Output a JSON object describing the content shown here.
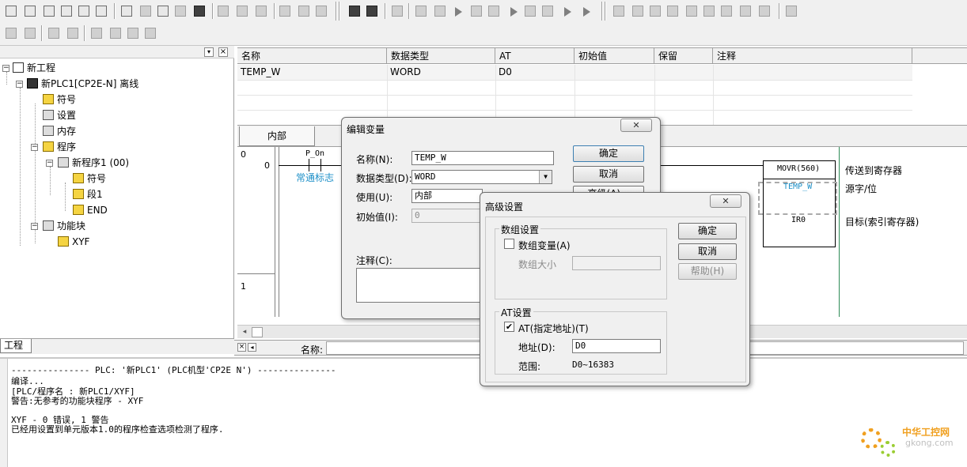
{
  "tree": {
    "items": [
      {
        "label": "新工程",
        "icon": "project-network-icon"
      },
      {
        "label": "新PLC1[CP2E-N] 离线",
        "icon": "plc-icon"
      },
      {
        "label": "符号",
        "icon": "symbols-icon"
      },
      {
        "label": "设置",
        "icon": "settings-icon"
      },
      {
        "label": "内存",
        "icon": "memory-icon"
      },
      {
        "label": "程序",
        "icon": "programs-icon"
      },
      {
        "label": "新程序1 (00)",
        "icon": "program-icon"
      },
      {
        "label": "符号",
        "icon": "symbols-icon"
      },
      {
        "label": "段1",
        "icon": "section-icon"
      },
      {
        "label": "END",
        "icon": "section-icon"
      },
      {
        "label": "功能块",
        "icon": "function-blocks-icon"
      },
      {
        "label": "XYF",
        "icon": "function-block-icon"
      }
    ],
    "tab_label": "工程"
  },
  "variable_table": {
    "headers": [
      "名称",
      "数据类型",
      "AT",
      "初始值",
      "保留",
      "注释"
    ],
    "rows": [
      {
        "name": "TEMP_W",
        "type": "WORD",
        "at": "D0",
        "init": "",
        "retain": "",
        "comment": ""
      }
    ],
    "tabs": [
      "内部"
    ]
  },
  "ladder": {
    "rung0_num": "0",
    "rung0_step": "0",
    "rung1_num": "1",
    "contact_name": "P_On",
    "contact_comment": "常通标志",
    "instr_name": "MOVR(560)",
    "instr_desc": "传送到寄存器",
    "operand1": "TEMP_W",
    "operand1_desc": "源字/位",
    "operand2": "IR0",
    "operand2_desc": "目标(索引寄存器)",
    "name_label": "名称:"
  },
  "edit_dialog": {
    "title": "编辑变量",
    "name_label": "名称(N):",
    "name_value": "TEMP_W",
    "type_label": "数据类型(D):",
    "type_value": "WORD",
    "usage_label": "使用(U):",
    "usage_value": "内部",
    "init_label": "初始值(I):",
    "init_value": "0",
    "comment_label": "注释(C):",
    "ok": "确定",
    "cancel": "取消",
    "advanced": "高级(A)..."
  },
  "adv_dialog": {
    "title": "高级设置",
    "array_group": "数组设置",
    "array_check_label": "数组变量(A)",
    "array_size_label": "数组大小",
    "at_group": "AT设置",
    "at_check_label": "AT(指定地址)(T)",
    "addr_label": "地址(D):",
    "addr_value": "D0",
    "range_label": "范围:",
    "range_value": "D0~16383",
    "ok": "确定",
    "cancel": "取消",
    "help": "帮助(H)"
  },
  "output": {
    "lines": [
      "--------------- PLC: '新PLC1' (PLC机型'CP2E N') ---------------",
      "编译...",
      "[PLC/程序名 : 新PLC1/XYF]",
      "警告:无参考的功能块程序 - XYF",
      "",
      "XYF - 0 错误, 1 警告",
      "已经用设置到单元版本1.0的程序检查选项检测了程序."
    ]
  },
  "watermark": {
    "line1": "中华工控网",
    "line2": "gkong.com"
  },
  "colors": {
    "accent_blue": "#1e90c8",
    "highlight_row": "#f4f4f4",
    "watermark_orange": "#f0a020"
  }
}
